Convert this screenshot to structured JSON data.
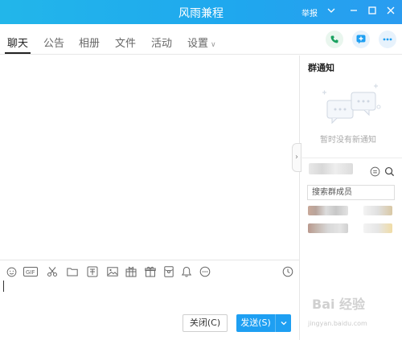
{
  "window": {
    "title": "风雨兼程",
    "report_label": "举报"
  },
  "tabs": [
    {
      "label": "聊天",
      "active": true
    },
    {
      "label": "公告"
    },
    {
      "label": "相册"
    },
    {
      "label": "文件"
    },
    {
      "label": "活动"
    },
    {
      "label": "设置"
    }
  ],
  "header_icons": [
    "phone-icon",
    "add-app-icon",
    "more-icon"
  ],
  "composer": {
    "toolbar_icons": [
      "emoji-icon",
      "gif-icon",
      "scissors-icon",
      "folder-icon",
      "sticker-icon",
      "image-icon",
      "gift-box-icon",
      "gift-icon",
      "red-packet-icon",
      "bell-icon",
      "more-icon",
      "history-icon"
    ],
    "close_label": "关闭(C)",
    "send_label": "发送(S)"
  },
  "sidebar": {
    "notice_title": "群通知",
    "notice_empty": "暂时没有新通知",
    "member_search_placeholder": "搜索群成员"
  },
  "watermark": {
    "text": "Bai 经验",
    "sub": "jingyan.baidu.com"
  },
  "colors": {
    "title_bar": "#1fa7ee",
    "send_button": "#1e9ff2",
    "accent_green": "#19a15f"
  }
}
